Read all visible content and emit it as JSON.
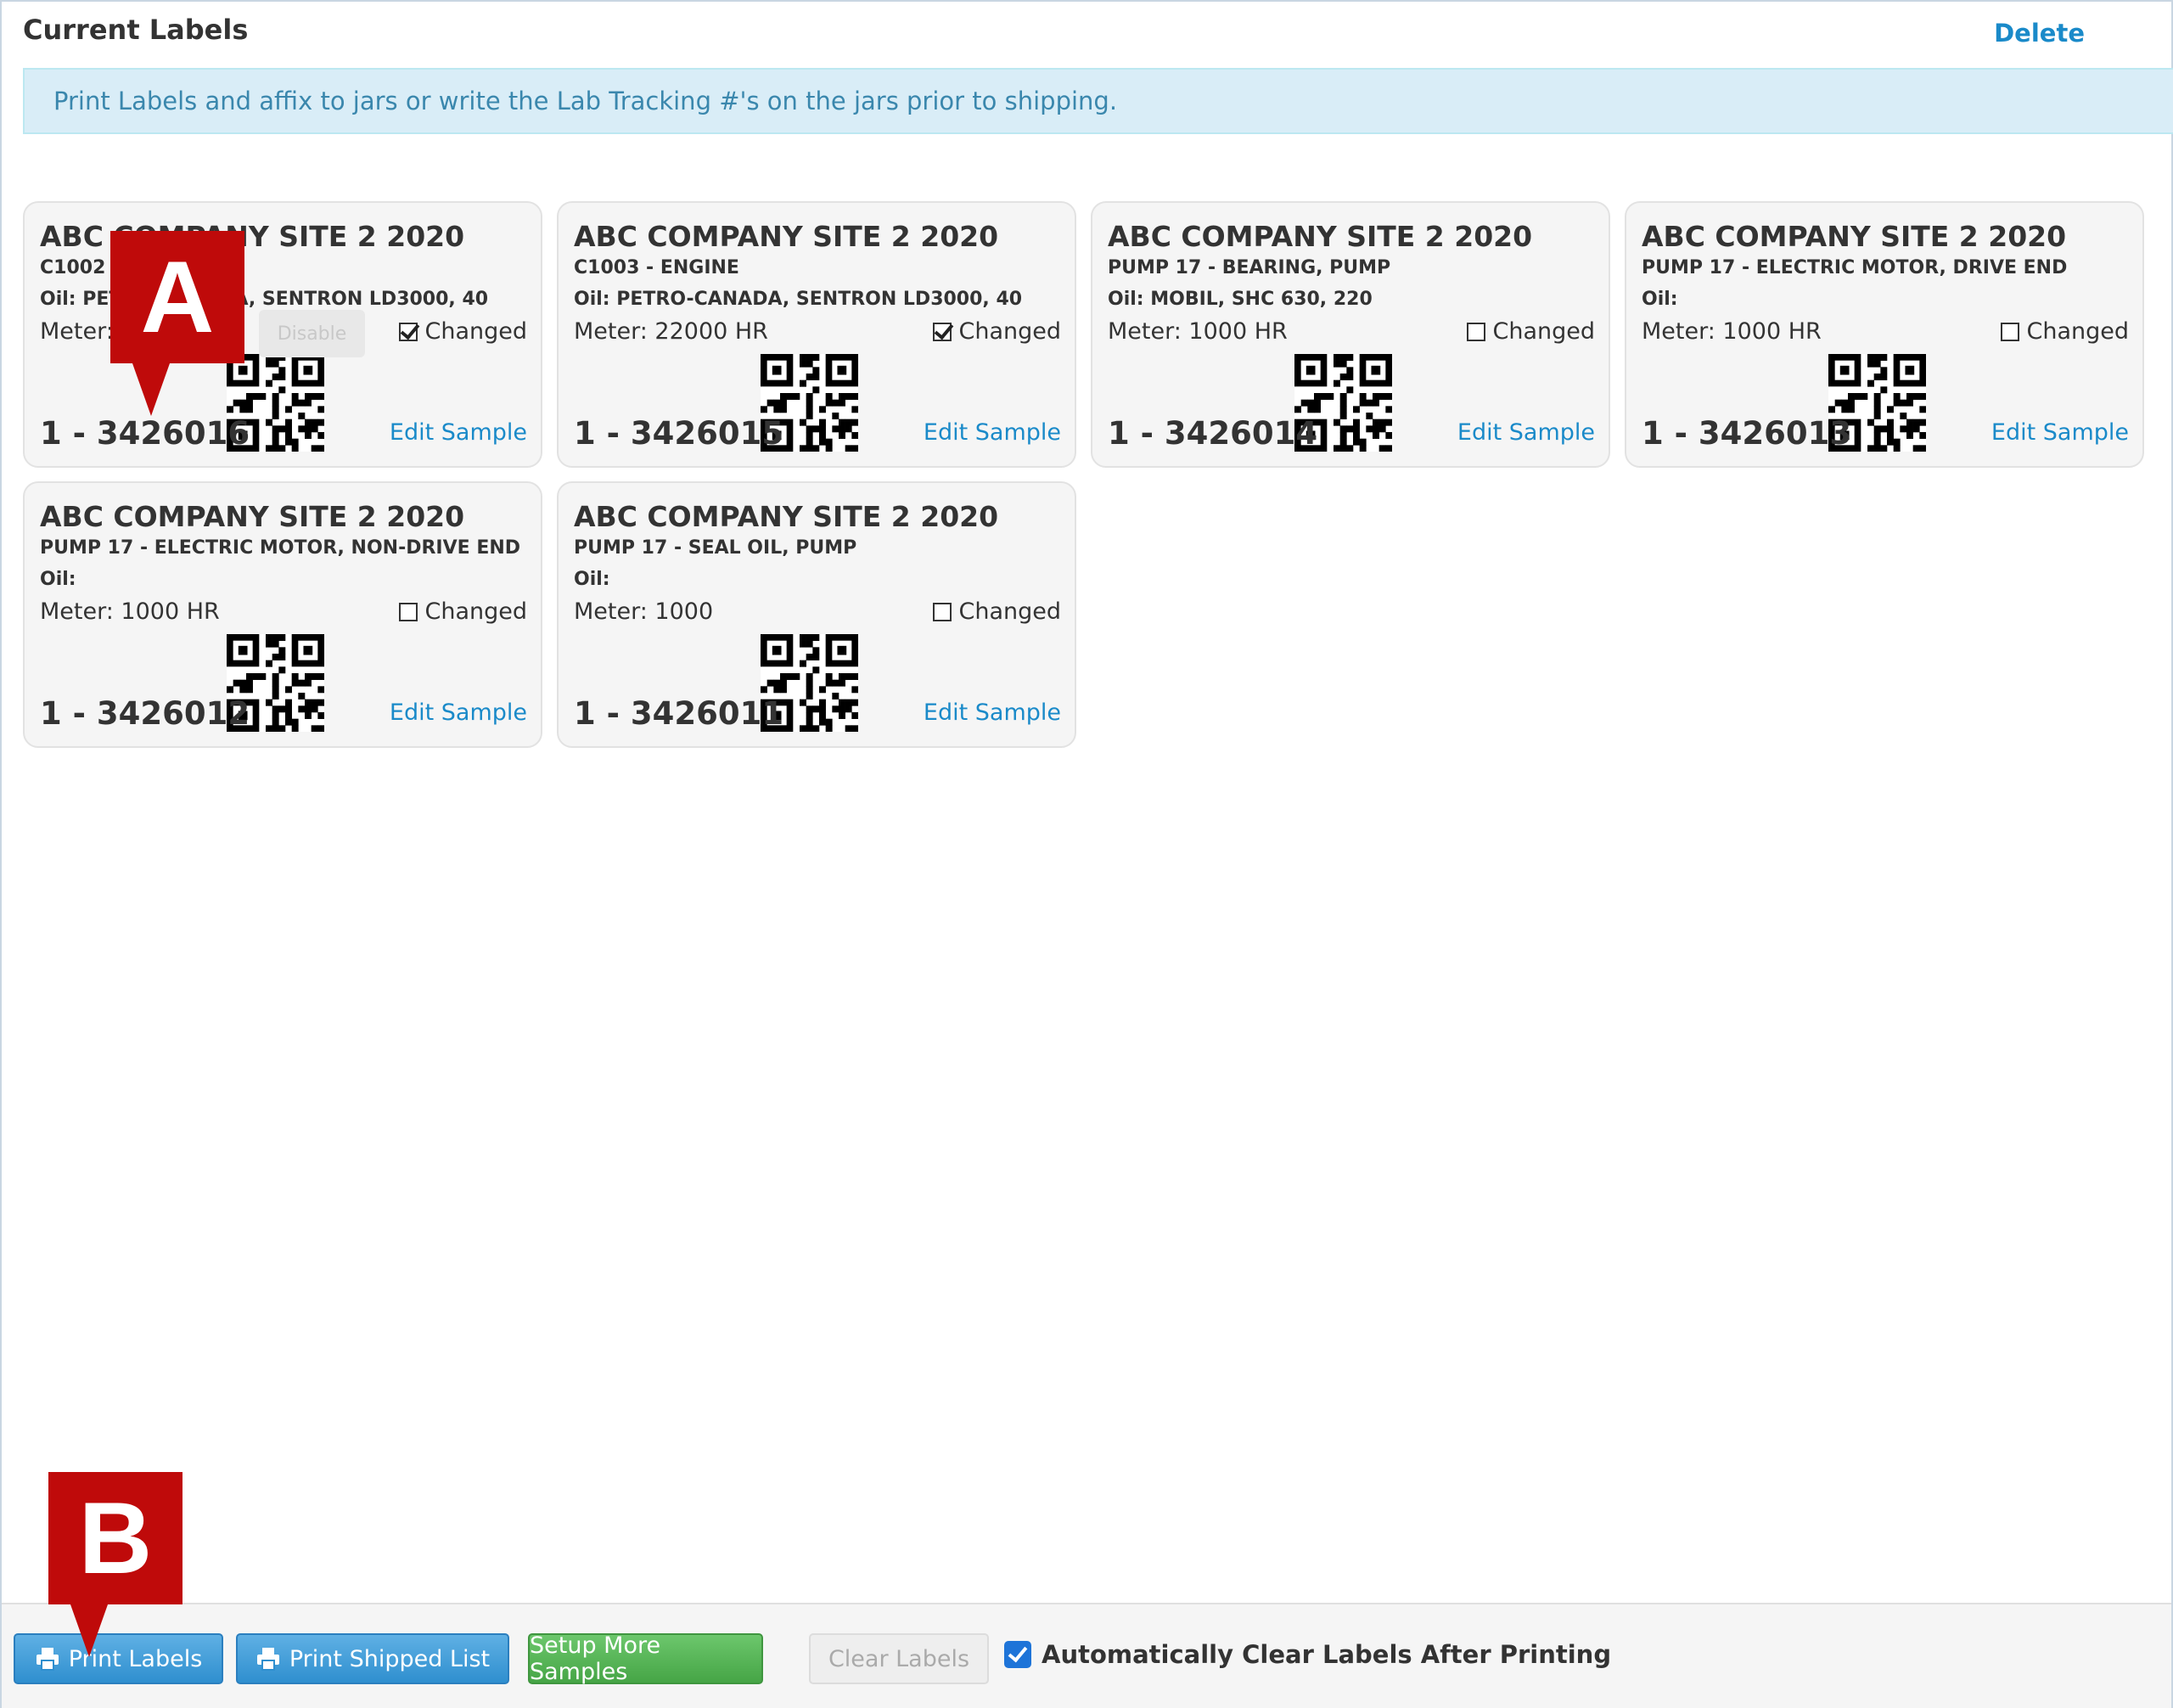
{
  "header": {
    "title": "Current Labels",
    "delete_label": "Delete"
  },
  "info_message": "Print Labels and affix to jars or write the Lab Tracking #'s on the jars prior to shipping.",
  "labels": [
    {
      "company": "ABC COMPANY SITE 2 2020",
      "point": "C1002 - ENGINE",
      "oil": "Oil: PETRO-CANADA, SENTRON LD3000, 40",
      "meter": "Meter: 20000 HR",
      "changed_label": "Changed",
      "changed": true,
      "tracking": "1 - 3426016",
      "edit_label": "Edit Sample"
    },
    {
      "company": "ABC COMPANY SITE 2 2020",
      "point": "C1003 - ENGINE",
      "oil": "Oil: PETRO-CANADA, SENTRON LD3000, 40",
      "meter": "Meter: 22000 HR",
      "changed_label": "Changed",
      "changed": true,
      "tracking": "1 - 3426015",
      "edit_label": "Edit Sample"
    },
    {
      "company": "ABC COMPANY SITE 2 2020",
      "point": "PUMP 17 - BEARING, PUMP",
      "oil": "Oil: MOBIL, SHC 630, 220",
      "meter": "Meter: 1000 HR",
      "changed_label": "Changed",
      "changed": false,
      "tracking": "1 - 3426014",
      "edit_label": "Edit Sample"
    },
    {
      "company": "ABC COMPANY SITE 2 2020",
      "point": "PUMP 17 - ELECTRIC MOTOR, DRIVE END",
      "oil": "Oil:",
      "meter": "Meter: 1000 HR",
      "changed_label": "Changed",
      "changed": false,
      "tracking": "1 - 3426013",
      "edit_label": "Edit Sample"
    },
    {
      "company": "ABC COMPANY SITE 2 2020",
      "point": "PUMP 17 - ELECTRIC MOTOR, NON-DRIVE END",
      "oil": "Oil:",
      "meter": "Meter: 1000 HR",
      "changed_label": "Changed",
      "changed": false,
      "tracking": "1 - 3426012",
      "edit_label": "Edit Sample"
    },
    {
      "company": "ABC COMPANY SITE 2 2020",
      "point": "PUMP 17 - SEAL OIL, PUMP",
      "oil": "Oil:",
      "meter": "Meter: 1000",
      "changed_label": "Changed",
      "changed": false,
      "tracking": "1 - 3426011",
      "edit_label": "Edit Sample"
    }
  ],
  "overlay_button_label": "Disable",
  "footer": {
    "print_labels": "Print Labels",
    "print_shipped_list": "Print Shipped List",
    "setup_more_samples": "Setup More Samples",
    "clear_labels": "Clear Labels",
    "auto_clear_label": "Automatically Clear Labels After Printing",
    "auto_clear_checked": true
  },
  "callouts": {
    "a": "A",
    "b": "B"
  },
  "colors": {
    "link": "#1a8ac9",
    "info_bg": "#d9edf7",
    "callout": "#bf0a0a",
    "primary": "#2f8fcf",
    "success": "#46a546"
  },
  "icons": {
    "printer": "printer-icon",
    "qr": "qr-code-icon"
  }
}
